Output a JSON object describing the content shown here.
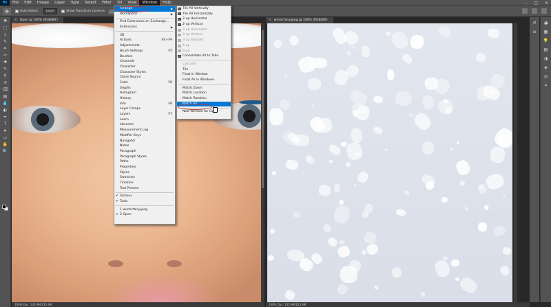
{
  "menubar": {
    "items": [
      "File",
      "Edit",
      "Image",
      "Layer",
      "Type",
      "Select",
      "Filter",
      "3D",
      "View",
      "Window",
      "Help"
    ],
    "active": "Window"
  },
  "optbar": {
    "auto_select_label": "Auto-Select:",
    "auto_select_value": "Layer",
    "transform_label": "Show Transform Controls"
  },
  "doc1": {
    "tab": "Open @ 100% (RGB/8#)",
    "status": "100%   Doc: 135.9M/135.9M"
  },
  "doc2": {
    "tab": "winterfairy.jpeg @ 100% (RGB/8#)",
    "status": "100%   Doc: 135.9M/135.9M"
  },
  "window_menu": {
    "items": [
      {
        "label": "Arrange",
        "arrow": true,
        "highlight": true
      },
      {
        "label": "Workspace",
        "arrow": true
      },
      {
        "sep": true
      },
      {
        "label": "Find Extensions on Exchange..."
      },
      {
        "label": "Extensions",
        "arrow": true
      },
      {
        "sep": true
      },
      {
        "label": "3D"
      },
      {
        "label": "Actions",
        "shortcut": "Alt+F9"
      },
      {
        "label": "Adjustments"
      },
      {
        "label": "Brush Settings",
        "shortcut": "F5"
      },
      {
        "label": "Brushes"
      },
      {
        "label": "Channels"
      },
      {
        "label": "Character"
      },
      {
        "label": "Character Styles"
      },
      {
        "label": "Clone Source"
      },
      {
        "label": "Color",
        "shortcut": "F6"
      },
      {
        "label": "Glyphs"
      },
      {
        "label": "Histogram"
      },
      {
        "label": "History"
      },
      {
        "label": "Info",
        "shortcut": "F8"
      },
      {
        "label": "Layer Comps"
      },
      {
        "label": "Layers",
        "shortcut": "F7"
      },
      {
        "label": "Learn"
      },
      {
        "label": "Libraries"
      },
      {
        "label": "Measurement Log"
      },
      {
        "label": "Modifier Keys"
      },
      {
        "label": "Navigator"
      },
      {
        "label": "Notes"
      },
      {
        "label": "Paragraph"
      },
      {
        "label": "Paragraph Styles"
      },
      {
        "label": "Paths"
      },
      {
        "label": "Properties"
      },
      {
        "label": "Styles"
      },
      {
        "label": "Swatches"
      },
      {
        "label": "Timeline"
      },
      {
        "label": "Tool Presets"
      },
      {
        "sep": true
      },
      {
        "label": "Options",
        "checked": true
      },
      {
        "label": "Tools",
        "checked": true
      },
      {
        "sep": true
      },
      {
        "label": "1 winterfairy.jpeg"
      },
      {
        "label": "2 Open",
        "checked": true
      }
    ]
  },
  "arrange_menu": {
    "items": [
      {
        "label": "Tile All Vertically",
        "icon": true
      },
      {
        "label": "Tile All Horizontally",
        "icon": true
      },
      {
        "label": "2-up Horizontal",
        "icon": true
      },
      {
        "label": "2-up Vertical",
        "icon": true
      },
      {
        "label": "3-up Horizontal",
        "icon": true,
        "disabled": true
      },
      {
        "label": "3-up Vertical",
        "icon": true,
        "disabled": true
      },
      {
        "label": "3-up Stacked",
        "icon": true,
        "disabled": true
      },
      {
        "label": "4-up",
        "icon": true,
        "disabled": true
      },
      {
        "label": "6-up",
        "icon": true,
        "disabled": true
      },
      {
        "label": "Consolidate All to Tabs",
        "icon": true
      },
      {
        "sep": true
      },
      {
        "label": "Cascade",
        "disabled": true
      },
      {
        "label": "Tile"
      },
      {
        "label": "Float in Window"
      },
      {
        "label": "Float All in Windows"
      },
      {
        "sep": true
      },
      {
        "label": "Match Zoom"
      },
      {
        "label": "Match Location"
      },
      {
        "label": "Match Rotation"
      },
      {
        "label": "Match All",
        "highlight": true
      },
      {
        "sep": true
      },
      {
        "label": "New Window for Open"
      }
    ]
  },
  "tools": [
    "move-tool-icon",
    "marquee-tool-icon",
    "lasso-tool-icon",
    "quick-select-icon",
    "crop-tool-icon",
    "eyedropper-icon",
    "healing-brush-icon",
    "brush-tool-icon",
    "clone-stamp-icon",
    "history-brush-icon",
    "eraser-tool-icon",
    "gradient-tool-icon",
    "blur-tool-icon",
    "dodge-tool-icon",
    "pen-tool-icon",
    "type-tool-icon",
    "path-select-icon",
    "shape-tool-icon",
    "hand-tool-icon",
    "zoom-tool-icon"
  ],
  "tool_glyphs": [
    "✥",
    "⬚",
    "ↄ",
    "✎",
    "⌗",
    "✑",
    "✚",
    "✎",
    "⚲",
    "↺",
    "⌫",
    "▤",
    "💧",
    "◐",
    "✒",
    "T",
    "➤",
    "▭",
    "✋",
    "🔍"
  ]
}
